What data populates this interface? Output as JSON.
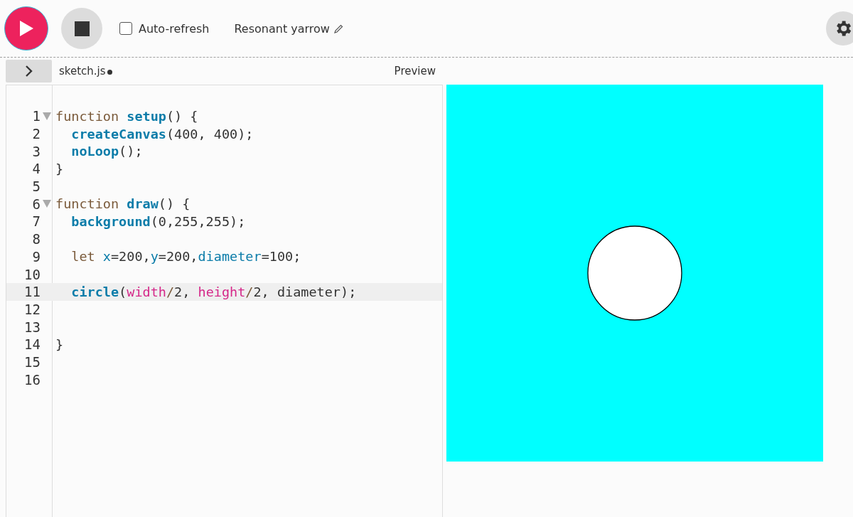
{
  "toolbar": {
    "auto_refresh": {
      "label": "Auto-refresh",
      "checked": false
    },
    "project_name": "Resonant yarrow"
  },
  "editor": {
    "file_tab": {
      "name": "sketch.js",
      "unsaved": true
    },
    "lines": [
      {
        "number": "1",
        "fold": true,
        "highlighted": false,
        "tokens": [
          {
            "kind": "kw",
            "text": "function "
          },
          {
            "kind": "def",
            "text": "setup"
          },
          {
            "kind": "plain",
            "text": "() {"
          }
        ]
      },
      {
        "number": "2",
        "fold": false,
        "highlighted": false,
        "tokens": [
          {
            "kind": "def",
            "text": "  createCanvas"
          },
          {
            "kind": "plain",
            "text": "(400, 400);"
          }
        ]
      },
      {
        "number": "3",
        "fold": false,
        "highlighted": false,
        "tokens": [
          {
            "kind": "def",
            "text": "  noLoop"
          },
          {
            "kind": "plain",
            "text": "();"
          }
        ]
      },
      {
        "number": "4",
        "fold": false,
        "highlighted": false,
        "tokens": [
          {
            "kind": "plain",
            "text": "}"
          }
        ]
      },
      {
        "number": "5",
        "fold": false,
        "highlighted": false
      },
      {
        "number": "6",
        "fold": true,
        "highlighted": false,
        "tokens": [
          {
            "kind": "kw",
            "text": "function "
          },
          {
            "kind": "def",
            "text": "draw"
          },
          {
            "kind": "plain",
            "text": "() {"
          }
        ]
      },
      {
        "number": "7",
        "fold": false,
        "highlighted": false,
        "tokens": [
          {
            "kind": "def",
            "text": "  background"
          },
          {
            "kind": "plain",
            "text": "(0,255,255);"
          }
        ]
      },
      {
        "number": "8",
        "fold": false,
        "highlighted": false
      },
      {
        "number": "9",
        "fold": false,
        "highlighted": false,
        "tokens": [
          {
            "kind": "kw",
            "text": "  let "
          },
          {
            "kind": "var",
            "text": "x"
          },
          {
            "kind": "plain",
            "text": "=200,"
          },
          {
            "kind": "var",
            "text": "y"
          },
          {
            "kind": "plain",
            "text": "=200,"
          },
          {
            "kind": "var",
            "text": "diameter"
          },
          {
            "kind": "plain",
            "text": "=100;"
          }
        ]
      },
      {
        "number": "10",
        "fold": false,
        "highlighted": false
      },
      {
        "number": "11",
        "fold": false,
        "highlighted": true,
        "tokens": [
          {
            "kind": "def",
            "text": "  circle"
          },
          {
            "kind": "plain",
            "text": "("
          },
          {
            "kind": "attr",
            "text": "width"
          },
          {
            "kind": "op",
            "text": "/"
          },
          {
            "kind": "plain",
            "text": "2, "
          },
          {
            "kind": "attr",
            "text": "height"
          },
          {
            "kind": "op",
            "text": "/"
          },
          {
            "kind": "plain",
            "text": "2, diameter);"
          }
        ]
      },
      {
        "number": "12",
        "fold": false,
        "highlighted": false
      },
      {
        "number": "13",
        "fold": false,
        "highlighted": false
      },
      {
        "number": "14",
        "fold": false,
        "highlighted": false,
        "tokens": [
          {
            "kind": "plain",
            "text": "}"
          }
        ]
      },
      {
        "number": "15",
        "fold": false,
        "highlighted": false
      },
      {
        "number": "16",
        "fold": false,
        "highlighted": false
      }
    ]
  },
  "preview": {
    "label": "Preview"
  }
}
